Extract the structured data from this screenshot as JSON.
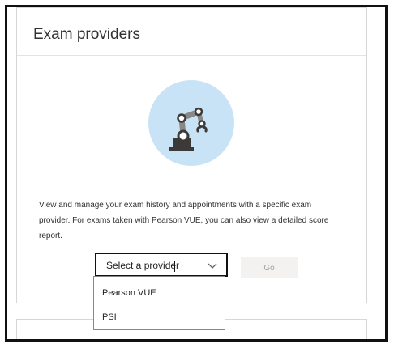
{
  "exam_providers": {
    "title": "Exam providers",
    "illustration_icon": "robot-arm-icon",
    "description": "View and manage your exam history and appointments with a specific exam provider. For exams taken with Pearson VUE, you can also view a detailed score report.",
    "select": {
      "value": "Select a provider",
      "expanded": true,
      "options": [
        "Pearson VUE",
        "PSI"
      ]
    },
    "go_label": "Go",
    "go_enabled": false
  },
  "colors": {
    "frame_border": "#111111",
    "card_border": "#d6d6d6",
    "illustration_bg": "#c9e3f6",
    "robot_dark": "#3b3a39",
    "button_bg": "#f3f2f1",
    "button_text": "#a19f9d"
  }
}
